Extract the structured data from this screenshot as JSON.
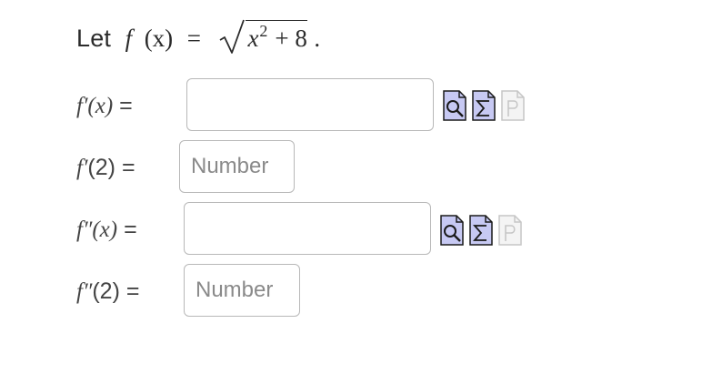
{
  "problem": {
    "let_word": "Let",
    "f_name": "f",
    "var_expr": "(x)",
    "equals": "=",
    "radicand_base": "x",
    "radicand_exp": "2",
    "radicand_rest": "+ 8",
    "period": "."
  },
  "rows": [
    {
      "func": "f′",
      "arg": "(x)",
      "equals": "=",
      "value": "",
      "placeholder": ""
    },
    {
      "func": "f′",
      "arg": "(2)",
      "equals": "=",
      "value": "",
      "placeholder": "Number"
    },
    {
      "func": "f″",
      "arg": "(x)",
      "equals": "=",
      "value": "",
      "placeholder": ""
    },
    {
      "func": "f″",
      "arg": "(2)",
      "equals": "=",
      "value": "",
      "placeholder": "Number"
    }
  ],
  "tool_icons": [
    "preview-icon",
    "equation-editor-icon",
    "parse-icon"
  ],
  "colors": {
    "tool_fill": "#c7c9f3",
    "tool_stroke": "#1a1a1a",
    "tool_disabled_fill": "#f4f4f4",
    "tool_disabled_stroke": "#c6c6c6",
    "field_border": "#b8b8b8"
  }
}
